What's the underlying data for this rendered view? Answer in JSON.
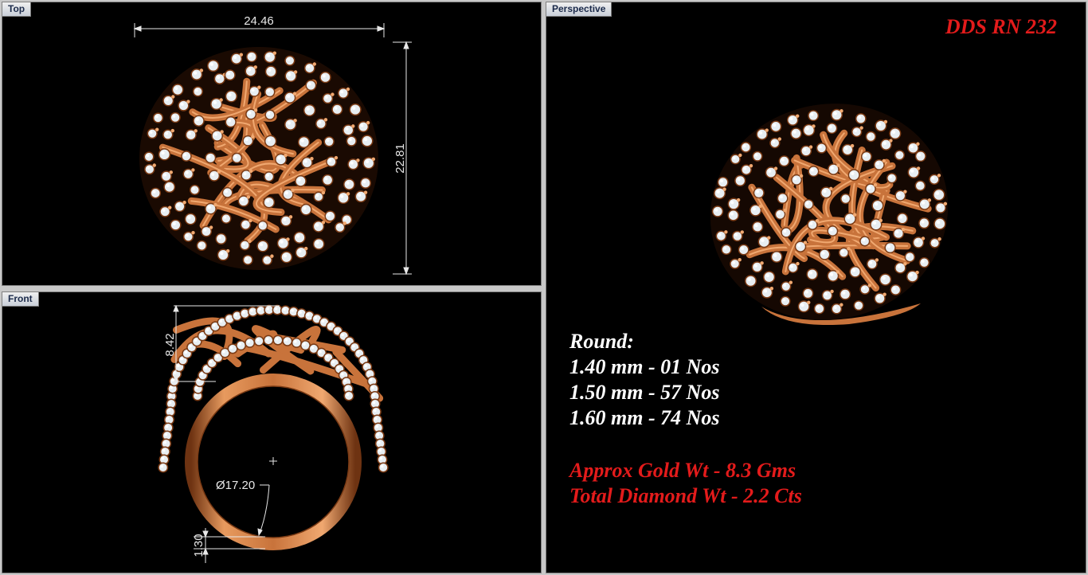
{
  "viewports": {
    "top": {
      "label": "Top"
    },
    "front": {
      "label": "Front"
    },
    "perspective": {
      "label": "Perspective"
    }
  },
  "dimensions": {
    "top_width": "24.46",
    "top_height": "22.81",
    "front_height": "8.42",
    "front_diameter": "Ø17.20",
    "front_thickness": "1.30"
  },
  "design_code": "DDS RN 232",
  "stones": {
    "heading": "Round:",
    "lines": [
      "1.40 mm - 01 Nos",
      "1.50 mm - 57 Nos",
      "1.60 mm - 74 Nos"
    ]
  },
  "weights": {
    "gold": "Approx Gold Wt - 8.3 Gms",
    "diamond": "Total Diamond Wt - 2.2 Cts"
  },
  "colors": {
    "gold": "#c8733b",
    "gold_dark": "#7a3a14",
    "gold_light": "#f0a870",
    "diamond": "#e8eef2",
    "background": "#000000",
    "accent_red": "#e31b1b"
  }
}
